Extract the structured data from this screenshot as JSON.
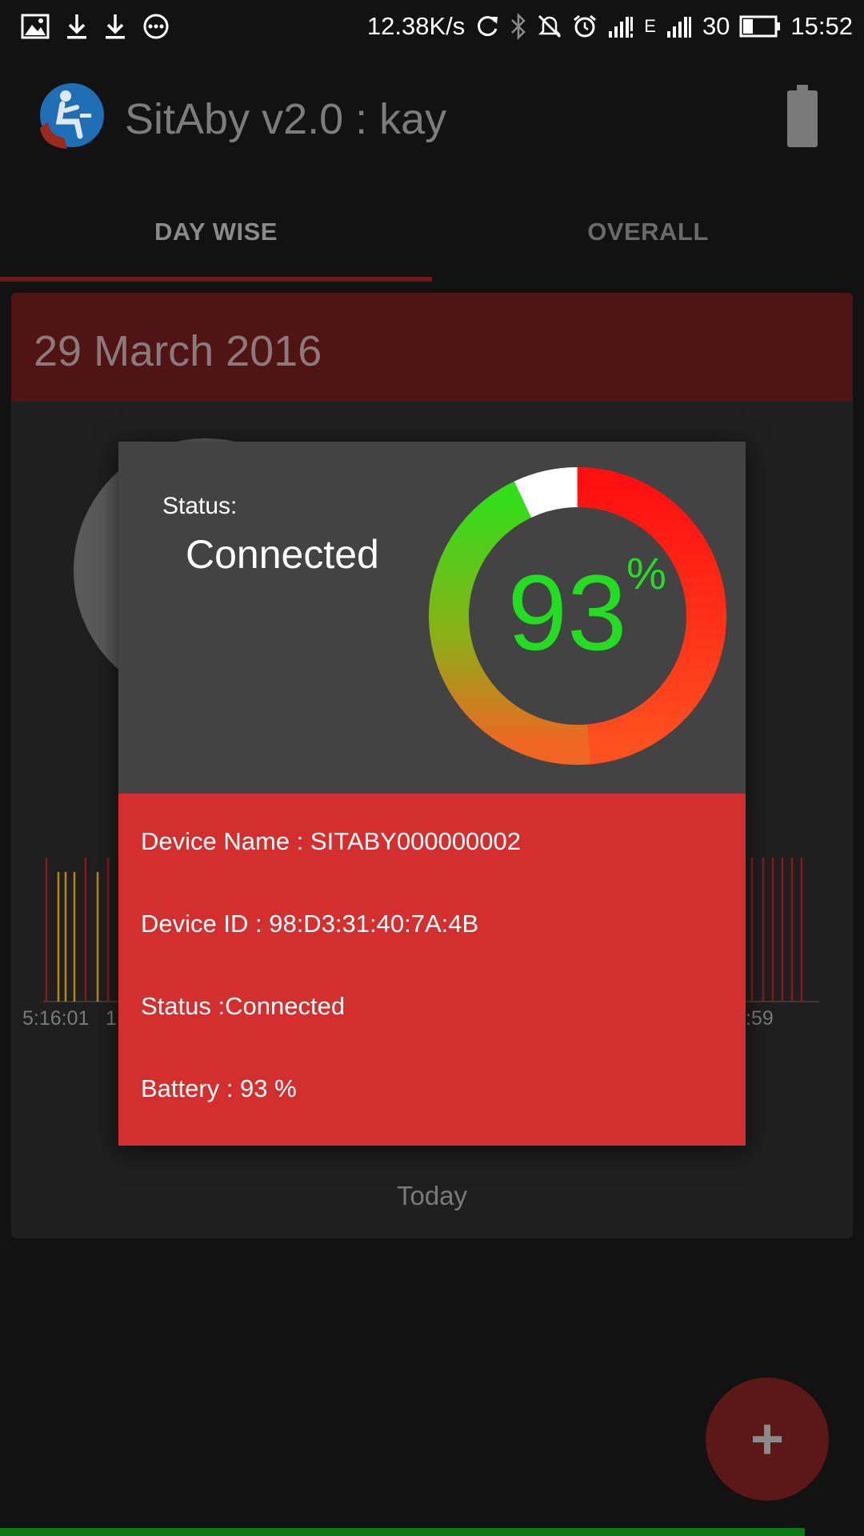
{
  "status_bar": {
    "net_speed": "12.38K/s",
    "network_type": "E",
    "battery_level": "30",
    "time": "15:52",
    "left_icons": [
      "image-icon",
      "download-icon",
      "download-icon",
      "more-icon"
    ],
    "right_icons": [
      "sync-icon",
      "bluetooth-icon",
      "mute-icon",
      "alarm-icon",
      "signal-icon",
      "signal-icon",
      "battery-icon"
    ]
  },
  "app_bar": {
    "title": "SitAby v2.0 : kay",
    "logo_icon": "sitting-person-logo",
    "action_icon": "battery-icon"
  },
  "tabs": [
    {
      "label": "DAY WISE",
      "selected": true
    },
    {
      "label": "OVERALL",
      "selected": false
    }
  ],
  "card": {
    "date": "29 March 2016",
    "axis_left": "5:16:01",
    "axis_left_2": "1",
    "axis_right": ":59",
    "footer": "Today"
  },
  "dialog": {
    "status_caption": "Status:",
    "status_value": "Connected",
    "gauge_value": "93",
    "gauge_unit": "%",
    "gauge_fraction": 0.93,
    "device_name": "Device Name : SITABY000000002",
    "device_id": "Device ID : 98:D3:31:40:7A:4B",
    "status_line": "Status :Connected",
    "battery_line": "Battery : 93 %"
  },
  "fab": {
    "label": "+"
  },
  "colors": {
    "accent_red": "#d32f2f",
    "gauge_green": "#22dd22",
    "dialog_gray": "#434343",
    "tab_indicator": "#6e1a1a"
  }
}
